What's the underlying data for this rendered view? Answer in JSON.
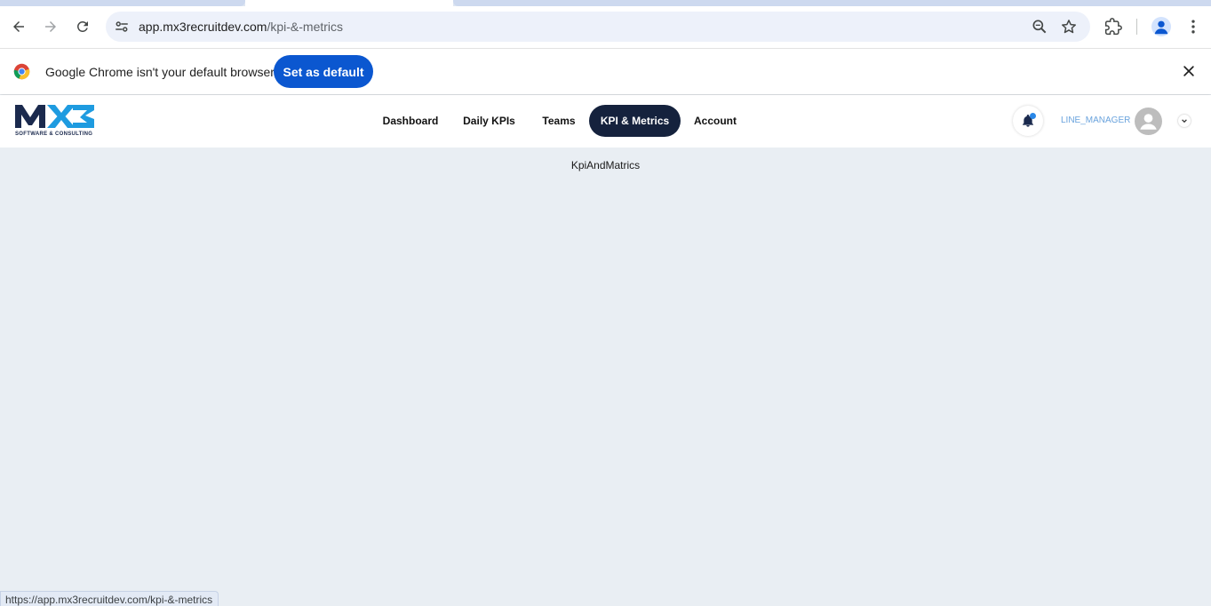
{
  "browser": {
    "url_domain": "app.mx3recruitdev.com",
    "url_path": "/kpi-&-metrics",
    "status_url": "https://app.mx3recruitdev.com/kpi-&-metrics"
  },
  "infobar": {
    "message": "Google Chrome isn't your default browser",
    "button_label": "Set as default"
  },
  "app": {
    "logo_tagline": "SOFTWARE & CONSULTING",
    "nav": {
      "dashboard": "Dashboard",
      "daily_kpis": "Daily KPIs",
      "teams": "Teams",
      "kpi_metrics": "KPI & Metrics",
      "account": "Account"
    },
    "user_role": "LINE_MANAGER",
    "page_text": "KpiAndMatrics"
  },
  "colors": {
    "nav_active_bg": "#15223d",
    "chrome_blue": "#0b57d0",
    "page_bg": "#e9eef3",
    "role_text": "#6aa3dd",
    "notification_dot": "#2a88e8"
  },
  "icons": [
    "back-icon",
    "forward-icon",
    "reload-icon",
    "site-settings-icon",
    "zoom-icon",
    "bookmark-star-icon",
    "extensions-icon",
    "profile-icon",
    "menu-icon",
    "chrome-logo-icon",
    "close-icon",
    "bell-icon",
    "avatar-icon",
    "chevron-down-icon"
  ]
}
